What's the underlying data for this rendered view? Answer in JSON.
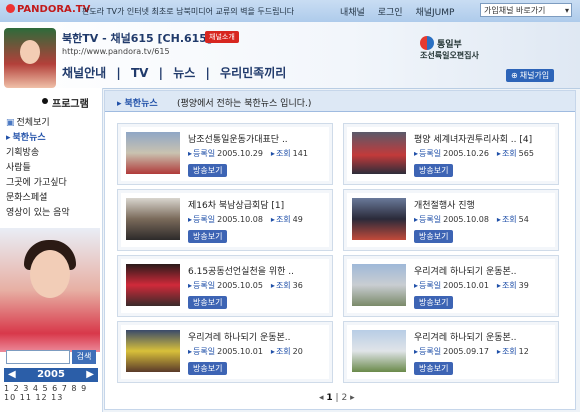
{
  "topbar": {
    "logo": "PANDORA.TV",
    "tagline": "판도라 TV가 인터넷 최초로 남북미디어 교류의 벽을 두드립니다",
    "links": [
      "내채널",
      "로그인",
      "채널JUMP"
    ],
    "channel_select": "가입채널 바로가기"
  },
  "header": {
    "title": "북한TV - 채널615 [CH.615]",
    "intro_tag": "채널소개",
    "url": "http://www.pandora.tv/615",
    "tabs": [
      "채널안내",
      "|",
      "TV",
      "|",
      "뉴스",
      "|",
      "우리민족끼리"
    ],
    "ministry": "통일부",
    "ministry_sub": "조선륙일오편집사",
    "join_button": "채널가입"
  },
  "sidebar": {
    "program_title": "프로그램",
    "menu": [
      "전체보기",
      "북한뉴스",
      "기획방송",
      "사람들",
      "그곳에 가고싶다",
      "문화스페셜",
      "영상이 있는 음악"
    ],
    "search_button": "검색",
    "year": "2005",
    "days": "1 2 3 4 5 6 7 8 9 10 11 12 13"
  },
  "main": {
    "category": "북한뉴스",
    "description": "(평양에서 전하는 북한뉴스 입니다.)",
    "reg_label": "등록일",
    "views_label": "조회",
    "watch_label": "방송보기",
    "cards": [
      {
        "title": "남조선통일운동가대표단 ..",
        "date": "2005.10.29",
        "views": "141"
      },
      {
        "title": "평양 세계녀자권투리사회 ..  [4]",
        "date": "2005.10.26",
        "views": "565"
      },
      {
        "title": "제16차 북남상급회담  [1]",
        "date": "2005.10.08",
        "views": "49"
      },
      {
        "title": "개천절행사 진행",
        "date": "2005.10.08",
        "views": "54"
      },
      {
        "title": "6.15공동선언실천을 위한 ..",
        "date": "2005.10.05",
        "views": "36"
      },
      {
        "title": "우리겨레 하나되기 운동본..",
        "date": "2005.10.01",
        "views": "39"
      },
      {
        "title": "우리겨레 하나되기 운동본..",
        "date": "2005.10.01",
        "views": "20"
      },
      {
        "title": "우리겨레 하나되기 운동본..",
        "date": "2005.09.17",
        "views": "12"
      }
    ],
    "pages": [
      "1",
      "2"
    ]
  }
}
